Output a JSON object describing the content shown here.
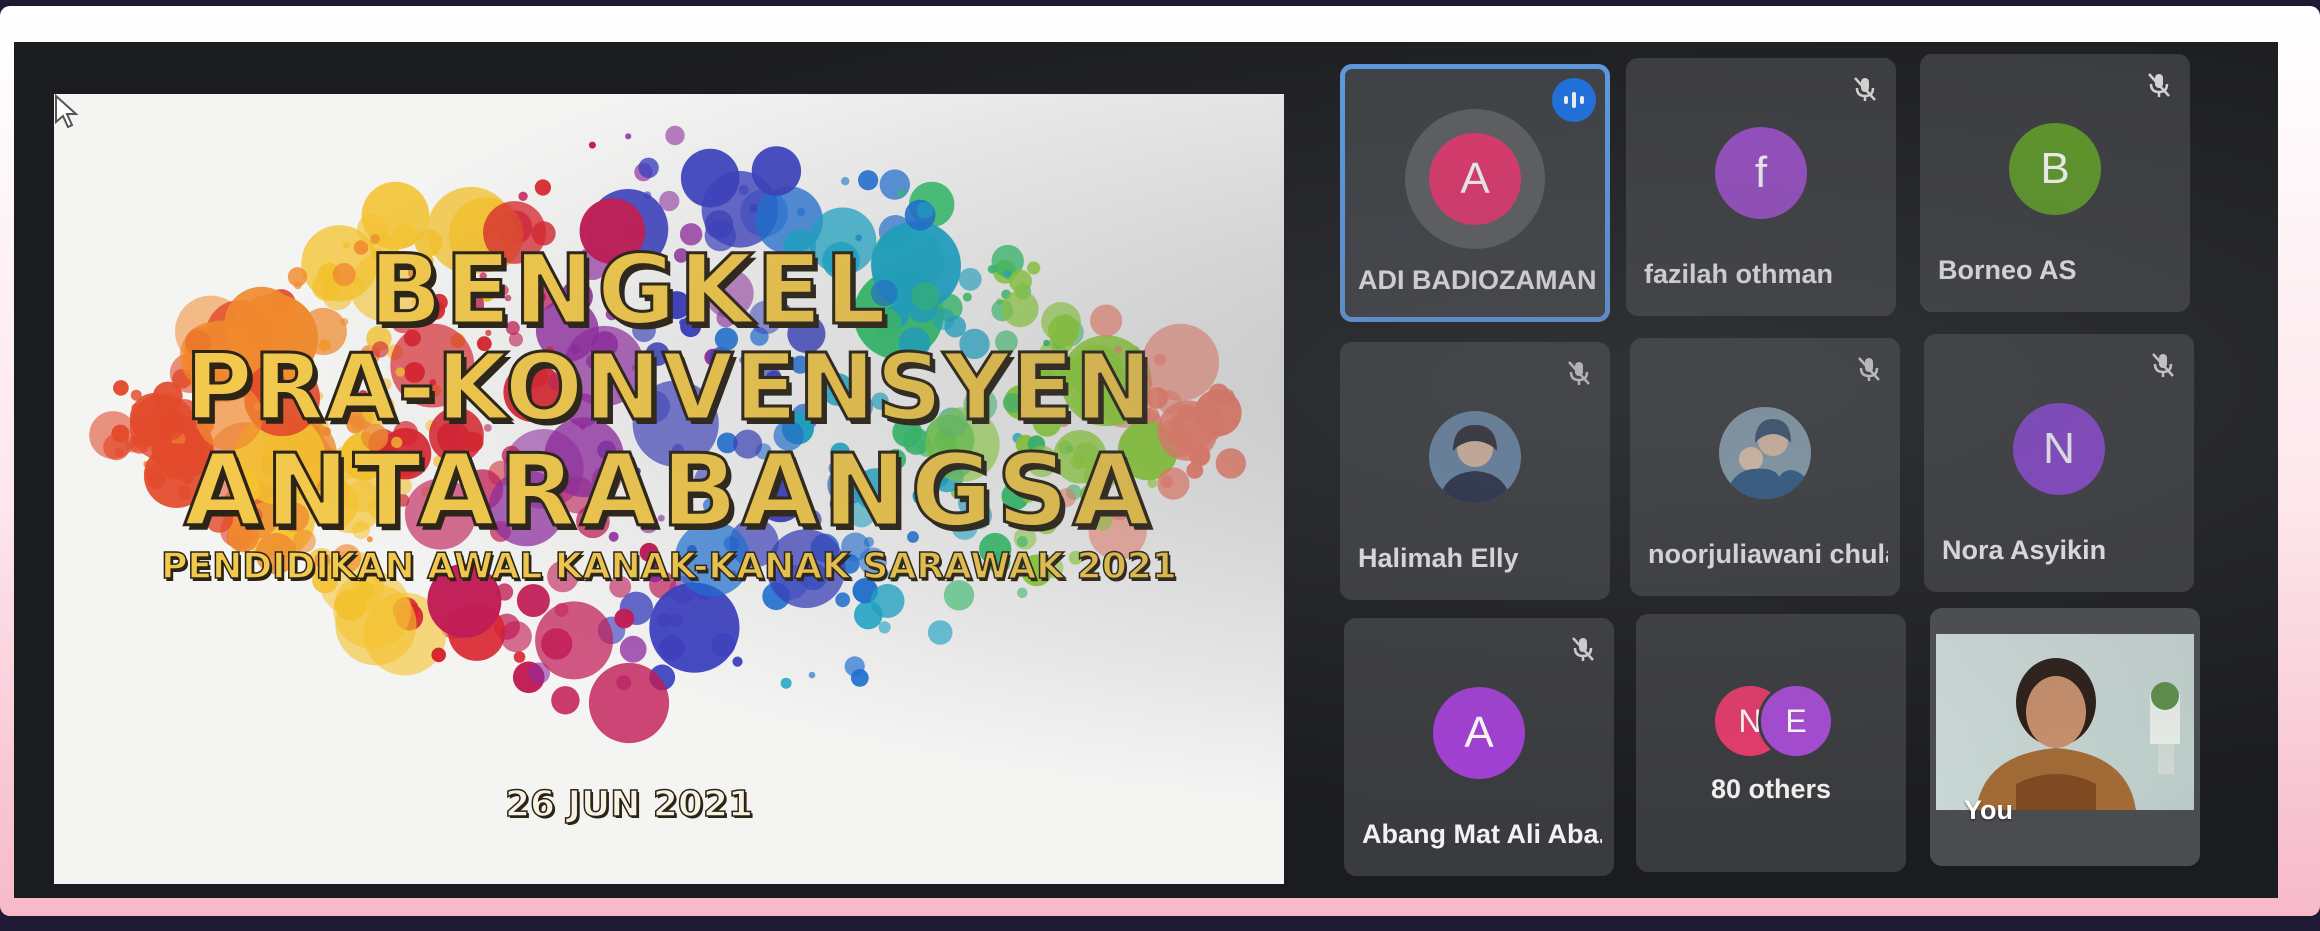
{
  "slide": {
    "line1": "BENGKEL",
    "line2": "PRA-KONVENSYEN",
    "line3": "ANTARABANGSA",
    "subtitle": "PENDIDIKAN AWAL KANAK-KANAK SARAWAK 2021",
    "date": "26 JUN 2021"
  },
  "participants": [
    {
      "name": "ADI BADIOZAMAN...",
      "initial": "A",
      "color": "#e8356e",
      "state": "speaking",
      "icon": "speaking-indicator-icon"
    },
    {
      "name": "fazilah othman",
      "initial": "f",
      "color": "#9b4dca",
      "state": "muted",
      "icon": "mic-off-icon"
    },
    {
      "name": "Borneo AS",
      "initial": "B",
      "color": "#5e9a25",
      "state": "muted",
      "icon": "mic-off-icon"
    },
    {
      "name": "Halimah Elly",
      "initial": "",
      "color": "#4a5d74",
      "state": "muted",
      "icon": "mic-off-icon"
    },
    {
      "name": "noorjuliawani chula",
      "initial": "",
      "color": "#4a6b8a",
      "state": "muted",
      "icon": "mic-off-icon"
    },
    {
      "name": "Nora Asyikin",
      "initial": "N",
      "color": "#8a46d1",
      "state": "muted",
      "icon": "mic-off-icon"
    },
    {
      "name": "Abang Mat Ali Aba...",
      "initial": "A",
      "color": "#a43fd6",
      "state": "muted",
      "icon": "mic-off-icon"
    }
  ],
  "others": {
    "label": "80 others",
    "initials": [
      "N",
      "E"
    ],
    "colors": [
      "#e73a6b",
      "#a84bd6"
    ]
  },
  "self": {
    "label": "You"
  },
  "accent": "#5d9ee9"
}
